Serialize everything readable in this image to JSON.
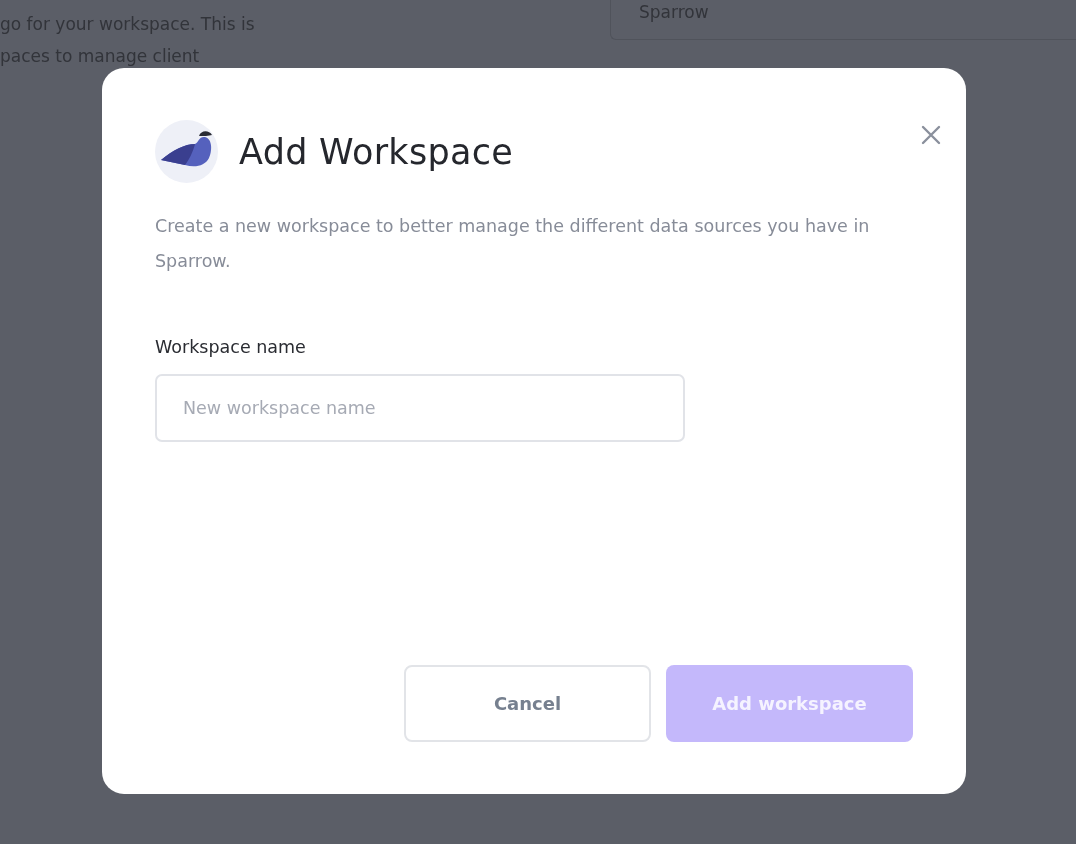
{
  "background": {
    "texts": [
      "go for your workspace. This is",
      "paces to manage client"
    ],
    "card_text": "Sparrow"
  },
  "dialog": {
    "title": "Add Workspace",
    "description": "Create a new workspace to better manage the different data sources you have in Sparrow.",
    "field": {
      "label": "Workspace name",
      "placeholder": "New workspace name"
    },
    "buttons": [
      {
        "label": "Cancel",
        "kind": "secondary",
        "disabled": false
      },
      {
        "label": "Add workspace",
        "kind": "primary",
        "disabled": true
      }
    ]
  }
}
